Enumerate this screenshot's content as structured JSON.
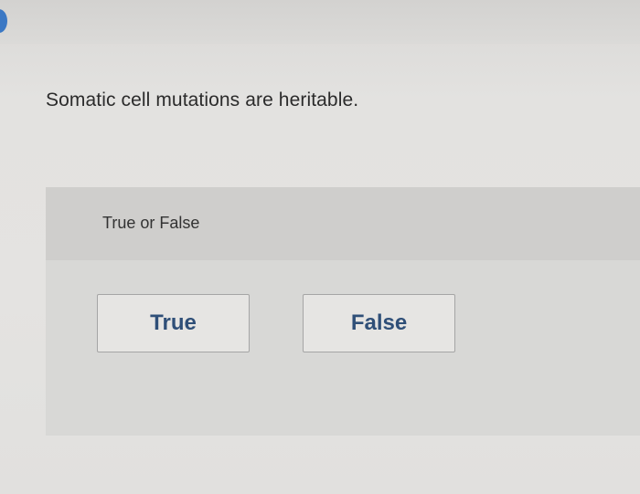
{
  "question": {
    "text": "Somatic cell mutations are heritable."
  },
  "answer_panel": {
    "prompt": "True or False",
    "options": [
      {
        "label": "True"
      },
      {
        "label": "False"
      }
    ]
  }
}
